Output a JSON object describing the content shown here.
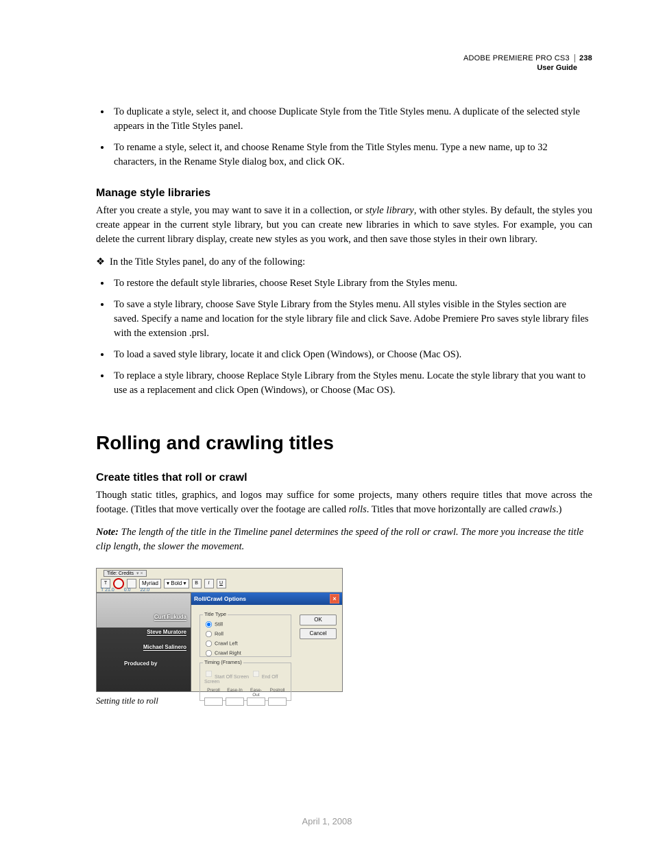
{
  "header": {
    "product": "ADOBE PREMIERE PRO CS3",
    "subtitle": "User Guide",
    "page_number": "238"
  },
  "intro_bullets": [
    "To duplicate a style, select it, and choose Duplicate Style from the Title Styles menu. A duplicate of the selected style appears in the Title Styles panel.",
    "To rename a style, select it, and choose Rename Style from the Title Styles menu. Type a new name, up to 32 characters, in the Rename Style dialog box, and click OK."
  ],
  "section_manage": {
    "heading": "Manage style libraries",
    "para_before_italic": "After you create a style, you may want to save it in a collection, or ",
    "italic_term": "style library",
    "para_after_italic": ", with other styles. By default, the styles you create appear in the current style library, but you can create new libraries in which to save styles. For example, you can delete the current library display, create new styles as you work, and then save those styles in their own library.",
    "diamond": "In the Title Styles panel, do any of the following:",
    "bullets": [
      "To restore the default style libraries, choose Reset Style Library from the Styles menu.",
      "To save a style library, choose Save Style Library from the Styles menu. All styles visible in the Styles section are saved. Specify a name and location for the style library file and click Save. Adobe Premiere Pro saves style library files with the extension .prsl.",
      "To load a saved style library, locate it and click Open (Windows), or Choose (Mac OS).",
      "To replace a style library, choose Replace Style Library from the Styles menu. Locate the style library that you want to use as a replacement and click Open (Windows), or Choose (Mac OS)."
    ]
  },
  "h1": "Rolling and crawling titles",
  "section_create": {
    "heading": "Create titles that roll or crawl",
    "para_pre": "Though static titles, graphics, and logos may suffice for some projects, many others require titles that move across the footage. (Titles that move vertically over the footage are called ",
    "rolls": "rolls",
    "para_mid": ". Titles that move horizontally are called ",
    "crawls": "crawls",
    "para_post": ".)",
    "note_lead": "Note:",
    "note_body": " The length of the title in the Timeline panel determines the speed of the roll or crawl. The more you increase the title clip length, the slower the movement."
  },
  "figure": {
    "tab_title": "Title: Credits",
    "font_family": "Myriad",
    "font_weight": "Bold",
    "format_b": "B",
    "format_i": "I",
    "format_u": "U",
    "ruler": [
      "21.0",
      "0.0",
      "22.0"
    ],
    "credits": {
      "c1": "Curt Fukuda",
      "c2": "Steve Muratore",
      "c3": "Michael Salinero",
      "c4": "Produced by"
    },
    "dialog": {
      "title": "Roll/Crawl Options",
      "close": "×",
      "title_type_legend": "Title Type",
      "radios": [
        "Still",
        "Roll",
        "Crawl Left",
        "Crawl Right"
      ],
      "timing_legend": "Timing (Frames)",
      "start_off": "Start Off Screen",
      "end_off": "End Off Screen",
      "cols": [
        "Preroll",
        "Ease-In",
        "Ease-Out",
        "Postroll"
      ],
      "ok": "OK",
      "cancel": "Cancel"
    },
    "caption": "Setting title to roll"
  },
  "footer_date": "April 1, 2008"
}
